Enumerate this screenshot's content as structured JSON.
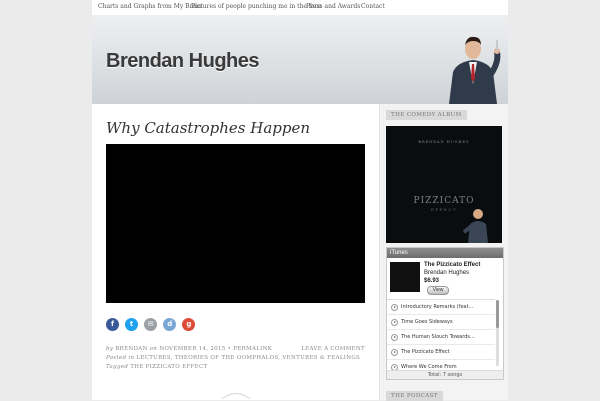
{
  "nav": {
    "items": [
      {
        "label": "Charts and Graphs from My Brain"
      },
      {
        "label": "Pictures of people punching me in the face"
      },
      {
        "label": "Press and Awards"
      },
      {
        "label": "Contact"
      }
    ]
  },
  "header": {
    "site_title": "Brendan Hughes"
  },
  "post": {
    "title": "Why Catastrophes Happen",
    "share": [
      {
        "name": "facebook",
        "glyph": "f",
        "color": "#3b5998"
      },
      {
        "name": "twitter",
        "glyph": "t",
        "color": "#1da1f2"
      },
      {
        "name": "email",
        "glyph": "✉",
        "color": "#9aa0a6"
      },
      {
        "name": "digg",
        "glyph": "d",
        "color": "#7aa6d6"
      },
      {
        "name": "googleplus",
        "glyph": "g",
        "color": "#dd4b39"
      }
    ],
    "meta_by": "by",
    "author": "BRENDAN",
    "meta_on": "on",
    "date": "NOVEMBER 14, 2015",
    "separator": "•",
    "permalink": "PERMALINK",
    "leave_comment": "LEAVE A COMMENT",
    "posted_in_label": "Posted in",
    "categories": "LECTURES, THEORIES OF THE OOMPHALOS, VENTURES & FEALINGS",
    "tagged_label": "Tagged",
    "tags": "THE PIZZICATO EFFECT"
  },
  "sidebar": {
    "album_widget_title": "THE COMEDY ALBUM",
    "album_top_text": "BRENDAN HUGHES",
    "album_title": "PIZZICATO",
    "album_sub": "EFFECT",
    "itunes": {
      "header": "iTunes",
      "album_title": "The Pizzicato Effect",
      "artist": "Brendan Hughes",
      "price": "$6.93",
      "view_label": "View",
      "tracks": [
        "Introductory Remarks (feat...",
        "Time Goes Sideways",
        "The Human Slouch Towards...",
        "The Pizzicato Effect",
        "Where We Come From"
      ],
      "total": "Total: 7 songs"
    },
    "podcast_widget_title": "THE PODCAST"
  }
}
